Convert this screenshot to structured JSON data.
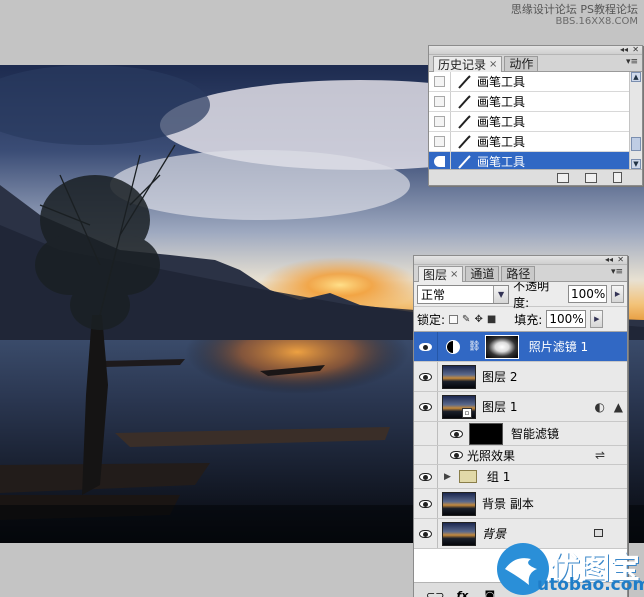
{
  "watermark_top": {
    "line1": "思缘设计论坛",
    "line2": "PS教程论坛",
    "line3": "BBS.16XX8.COM"
  },
  "history_panel": {
    "tabs": [
      {
        "label": "历史记录",
        "active": true,
        "closable": true
      },
      {
        "label": "动作",
        "active": false
      }
    ],
    "items": [
      {
        "label": "画笔工具",
        "selected": false
      },
      {
        "label": "画笔工具",
        "selected": false
      },
      {
        "label": "画笔工具",
        "selected": false
      },
      {
        "label": "画笔工具",
        "selected": false
      },
      {
        "label": "画笔工具",
        "selected": true
      }
    ],
    "footer_icons": [
      "new-document-from-state-icon",
      "new-snapshot-icon",
      "trash-icon"
    ]
  },
  "layers_panel": {
    "tabs": [
      {
        "label": "图层",
        "active": true,
        "closable": true
      },
      {
        "label": "通道",
        "active": false
      },
      {
        "label": "路径",
        "active": false
      }
    ],
    "blend_mode": "正常",
    "opacity_label": "不透明度:",
    "opacity_value": "100%",
    "lock_label": "锁定:",
    "fill_label": "填充:",
    "fill_value": "100%",
    "layers": [
      {
        "name": "照片滤镜 1",
        "type": "adjustment",
        "selected": true
      },
      {
        "name": "图层 2",
        "type": "pixel"
      },
      {
        "name": "图层 1",
        "type": "smart-object"
      },
      {
        "name": "智能滤镜",
        "type": "smart-filter-mask"
      },
      {
        "name": "光照效果",
        "type": "filter-effect"
      },
      {
        "name": "组 1",
        "type": "group"
      },
      {
        "name": "背景 副本",
        "type": "pixel"
      },
      {
        "name": "背景",
        "type": "background"
      }
    ],
    "footer_icons": [
      "link-icon",
      "fx-icon",
      "mask-icon"
    ]
  },
  "watermark_bottom": {
    "cn": "优图宝",
    "en": "utobao.com"
  }
}
